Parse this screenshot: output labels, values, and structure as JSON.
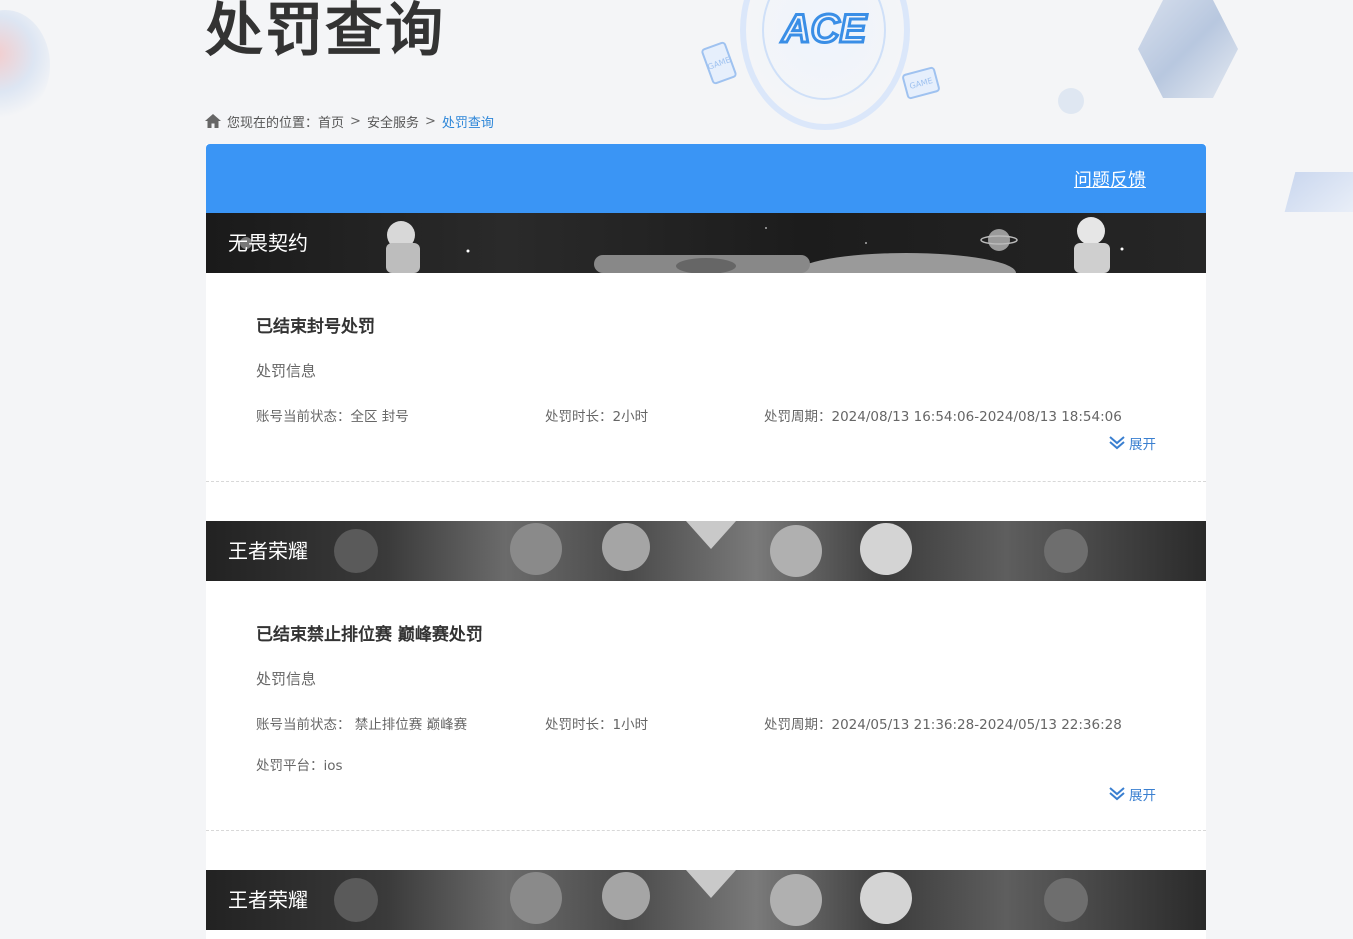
{
  "header": {
    "title": "处罚查询"
  },
  "breadcrumb": {
    "prefix": "您现在的位置：",
    "items": [
      "首页",
      "安全服务",
      "处罚查询"
    ],
    "separator": ">"
  },
  "toolbar": {
    "feedback_label": "问题反馈"
  },
  "colors": {
    "accent": "#3a95f5",
    "link": "#2d86d8"
  },
  "logo_text": "ACE",
  "decor": {
    "game_tile_label": "GAME"
  },
  "records": [
    {
      "game": "无畏契约",
      "title": "已结束封号处罚",
      "info_label": "处罚信息",
      "status": "账号当前状态：全区 封号",
      "duration": "处罚时长：2小时",
      "period": "处罚周期：2024/08/13 16:54:06-2024/08/13 18:54:06",
      "expand_label": "展开"
    },
    {
      "game": "王者荣耀",
      "title": "已结束禁止排位赛 巅峰赛处罚",
      "info_label": "处罚信息",
      "status": "账号当前状态：  禁止排位赛 巅峰赛",
      "duration": "处罚时长：1小时",
      "period": "处罚周期：2024/05/13 21:36:28-2024/05/13 22:36:28",
      "platform": "处罚平台：ios",
      "expand_label": "展开"
    },
    {
      "game": "王者荣耀"
    }
  ]
}
